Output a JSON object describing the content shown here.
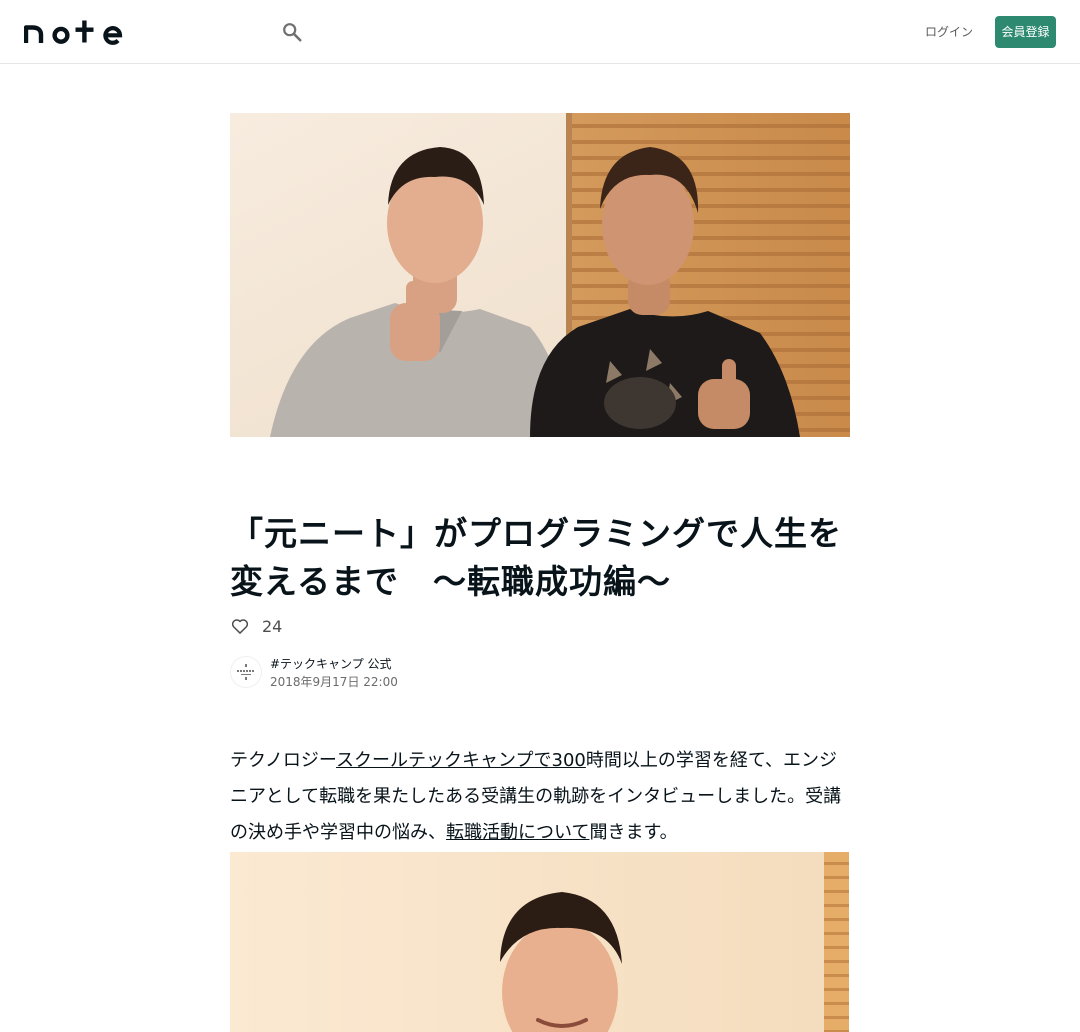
{
  "header": {
    "logo_text": "note",
    "search_icon": "search-icon",
    "login_label": "ログイン",
    "signup_label": "会員登録",
    "accent_color": "#2d8a70"
  },
  "article": {
    "title": "「元ニート」がプログラミングで人生を変えるまで　〜転職成功編〜",
    "like_icon": "heart-outline-icon",
    "like_count": "24",
    "author_name": "#テックキャンプ 公式",
    "date": "2018年9月17日 22:00",
    "body": {
      "part1": "テクノロジー",
      "link1": "スクールテックキャンプで300",
      "part2": "時間以上の学習を経て、エンジニアとして転職を果たしたある受講生の軌跡をインタビューしました。受講の決め手や学習中の悩み、",
      "link2": "転職活動について",
      "part3": "聞きます。"
    },
    "images": {
      "hero": "hero-photo-two-men-thumbs-up",
      "second": "article-photo-portrait"
    }
  }
}
